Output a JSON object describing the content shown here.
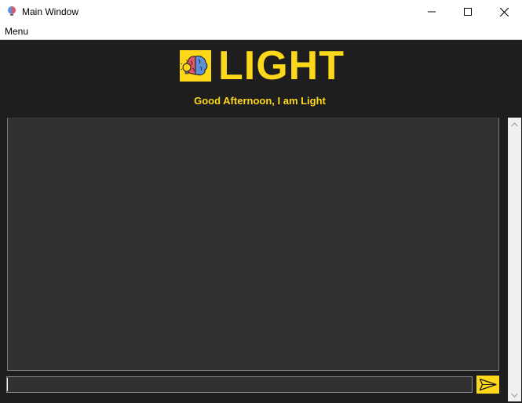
{
  "window": {
    "title": "Main Window",
    "icon": "brain-bulb-icon"
  },
  "menubar": {
    "items": [
      "Menu"
    ]
  },
  "header": {
    "app_name": "LIGHT",
    "greeting": "Good Afternoon, I am Light",
    "logo_icon": "brain-lightbulb-logo-icon"
  },
  "chat": {
    "messages": []
  },
  "input": {
    "value": "",
    "placeholder": ""
  },
  "send_button": {
    "icon": "send-arrow-icon"
  },
  "colors": {
    "accent": "#fdd81a",
    "background": "#1e1e1e",
    "panel": "#313131"
  }
}
